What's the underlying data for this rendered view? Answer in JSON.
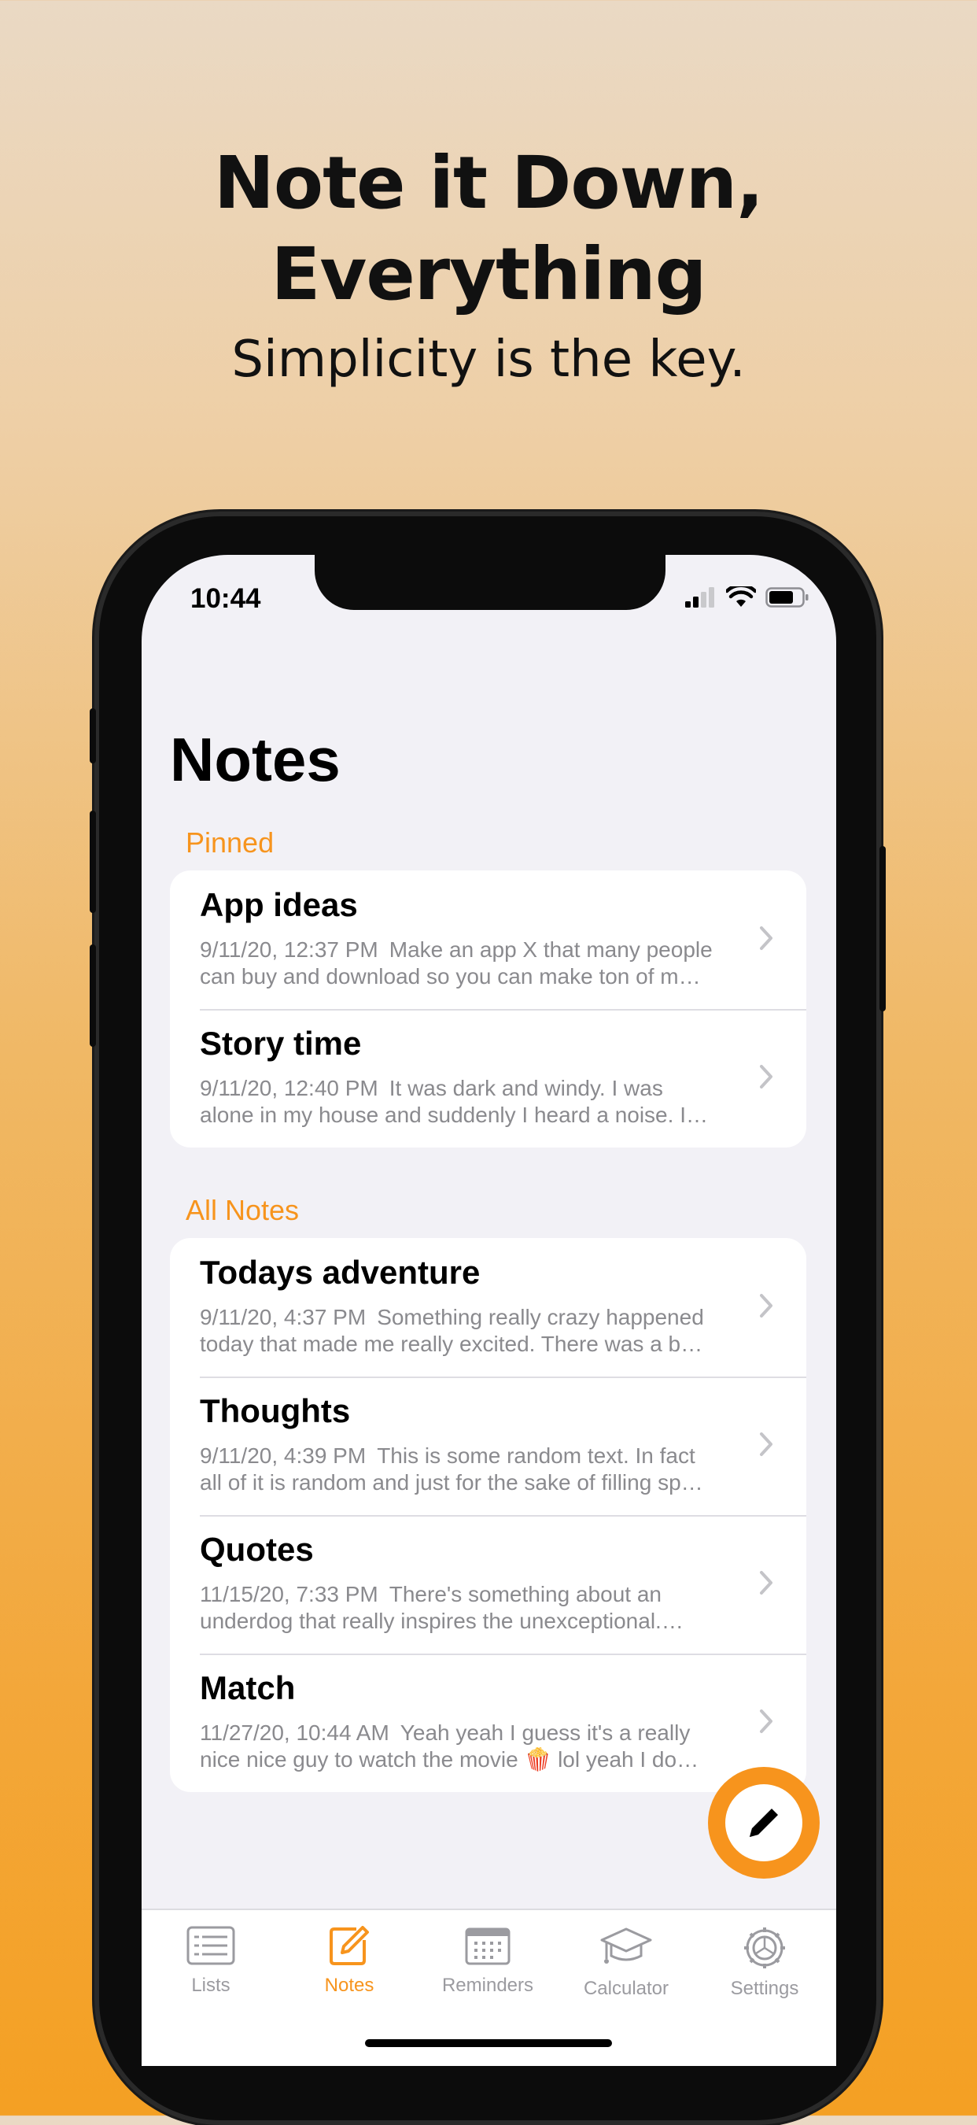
{
  "promo": {
    "headline_line1": "Note it Down,",
    "headline_line2": "Everything",
    "subheadline": "Simplicity is the key."
  },
  "status_bar": {
    "time": "10:44"
  },
  "page": {
    "title": "Notes"
  },
  "pinned": {
    "header": "Pinned",
    "notes": [
      {
        "title": "App ideas",
        "date": "9/11/20, 12:37 PM",
        "preview_line1": "Make an app X that many people",
        "preview_line2": "can buy and download so you can make ton of m…"
      },
      {
        "title": "Story time",
        "date": "9/11/20, 12:40 PM",
        "preview_line1": "It was dark and windy. I was",
        "preview_line2": "alone in my house and suddenly I heard a noise. I…"
      }
    ]
  },
  "all_notes": {
    "header": "All Notes",
    "notes": [
      {
        "title": "Todays adventure",
        "date": "9/11/20, 4:37 PM",
        "preview_line1": "Something really crazy happened",
        "preview_line2": "today that made me really excited. There was a b…"
      },
      {
        "title": "Thoughts",
        "date": "9/11/20, 4:39 PM",
        "preview_line1": "This is some random text. In fact",
        "preview_line2": "all of it is random and just for the sake of filling sp…"
      },
      {
        "title": "Quotes",
        "date": "11/15/20, 7:33 PM",
        "preview_line1": "There's something about an",
        "preview_line2": "underdog that really inspires the unexceptional.…"
      },
      {
        "title": "Match",
        "date": "11/27/20, 10:44 AM",
        "preview_line1": "Yeah yeah I guess it's a really",
        "preview_line2": "nice nice guy to watch the movie 🍿 lol yeah I do…"
      }
    ]
  },
  "fab": {
    "icon": "pencil-icon"
  },
  "tabbar": {
    "tabs": [
      {
        "label": "Lists",
        "icon": "list-icon"
      },
      {
        "label": "Notes",
        "icon": "compose-icon"
      },
      {
        "label": "Reminders",
        "icon": "calendar-icon"
      },
      {
        "label": "Calculator",
        "icon": "graduation-cap-icon"
      },
      {
        "label": "Settings",
        "icon": "gear-icon"
      }
    ],
    "active": "Notes"
  },
  "colors": {
    "accent": "#f7941d",
    "background": "#f2f1f6",
    "secondary_text": "#8a8a8e"
  }
}
